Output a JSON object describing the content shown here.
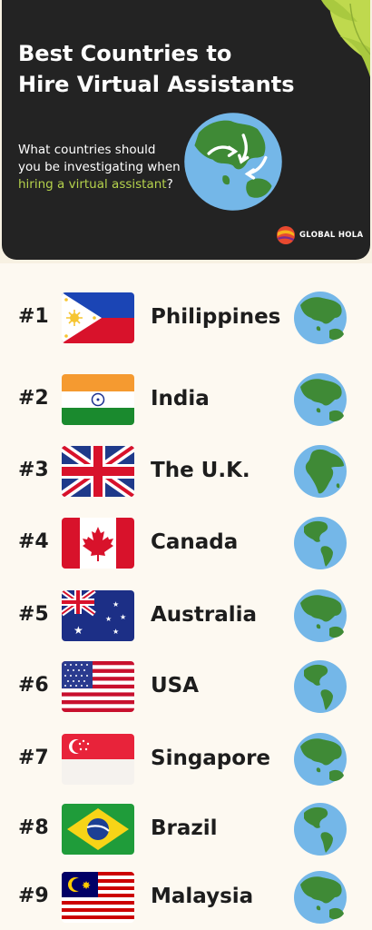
{
  "header": {
    "title_line1": "Best Countries to",
    "title_line2": "Hire Virtual Assistants",
    "question_pre": "What countries should you be investigating when ",
    "question_highlight": "hiring a virtual assistant",
    "question_post": "?",
    "brand": "GLOBAL HOLA"
  },
  "countries": [
    {
      "rank": "#1",
      "name": "Philippines",
      "flag": "philippines-flag-icon",
      "globe": "asia-globe-icon"
    },
    {
      "rank": "#2",
      "name": "India",
      "flag": "india-flag-icon",
      "globe": "asia-globe-icon"
    },
    {
      "rank": "#3",
      "name": "The U.K.",
      "flag": "uk-flag-icon",
      "globe": "europe-africa-globe-icon"
    },
    {
      "rank": "#4",
      "name": "Canada",
      "flag": "canada-flag-icon",
      "globe": "americas-globe-icon"
    },
    {
      "rank": "#5",
      "name": "Australia",
      "flag": "australia-flag-icon",
      "globe": "asia-globe-icon"
    },
    {
      "rank": "#6",
      "name": "USA",
      "flag": "usa-flag-icon",
      "globe": "americas-globe-icon"
    },
    {
      "rank": "#7",
      "name": "Singapore",
      "flag": "singapore-flag-icon",
      "globe": "asia-globe-icon"
    },
    {
      "rank": "#8",
      "name": "Brazil",
      "flag": "brazil-flag-icon",
      "globe": "americas-globe-icon"
    },
    {
      "rank": "#9",
      "name": "Malaysia",
      "flag": "malaysia-flag-icon",
      "globe": "asia-globe-icon"
    }
  ],
  "colors": {
    "panel": "#232323",
    "highlight": "#b5d24c",
    "background": "#fdf9f1",
    "ocean": "#74b7e8",
    "land": "#3f8a36"
  }
}
